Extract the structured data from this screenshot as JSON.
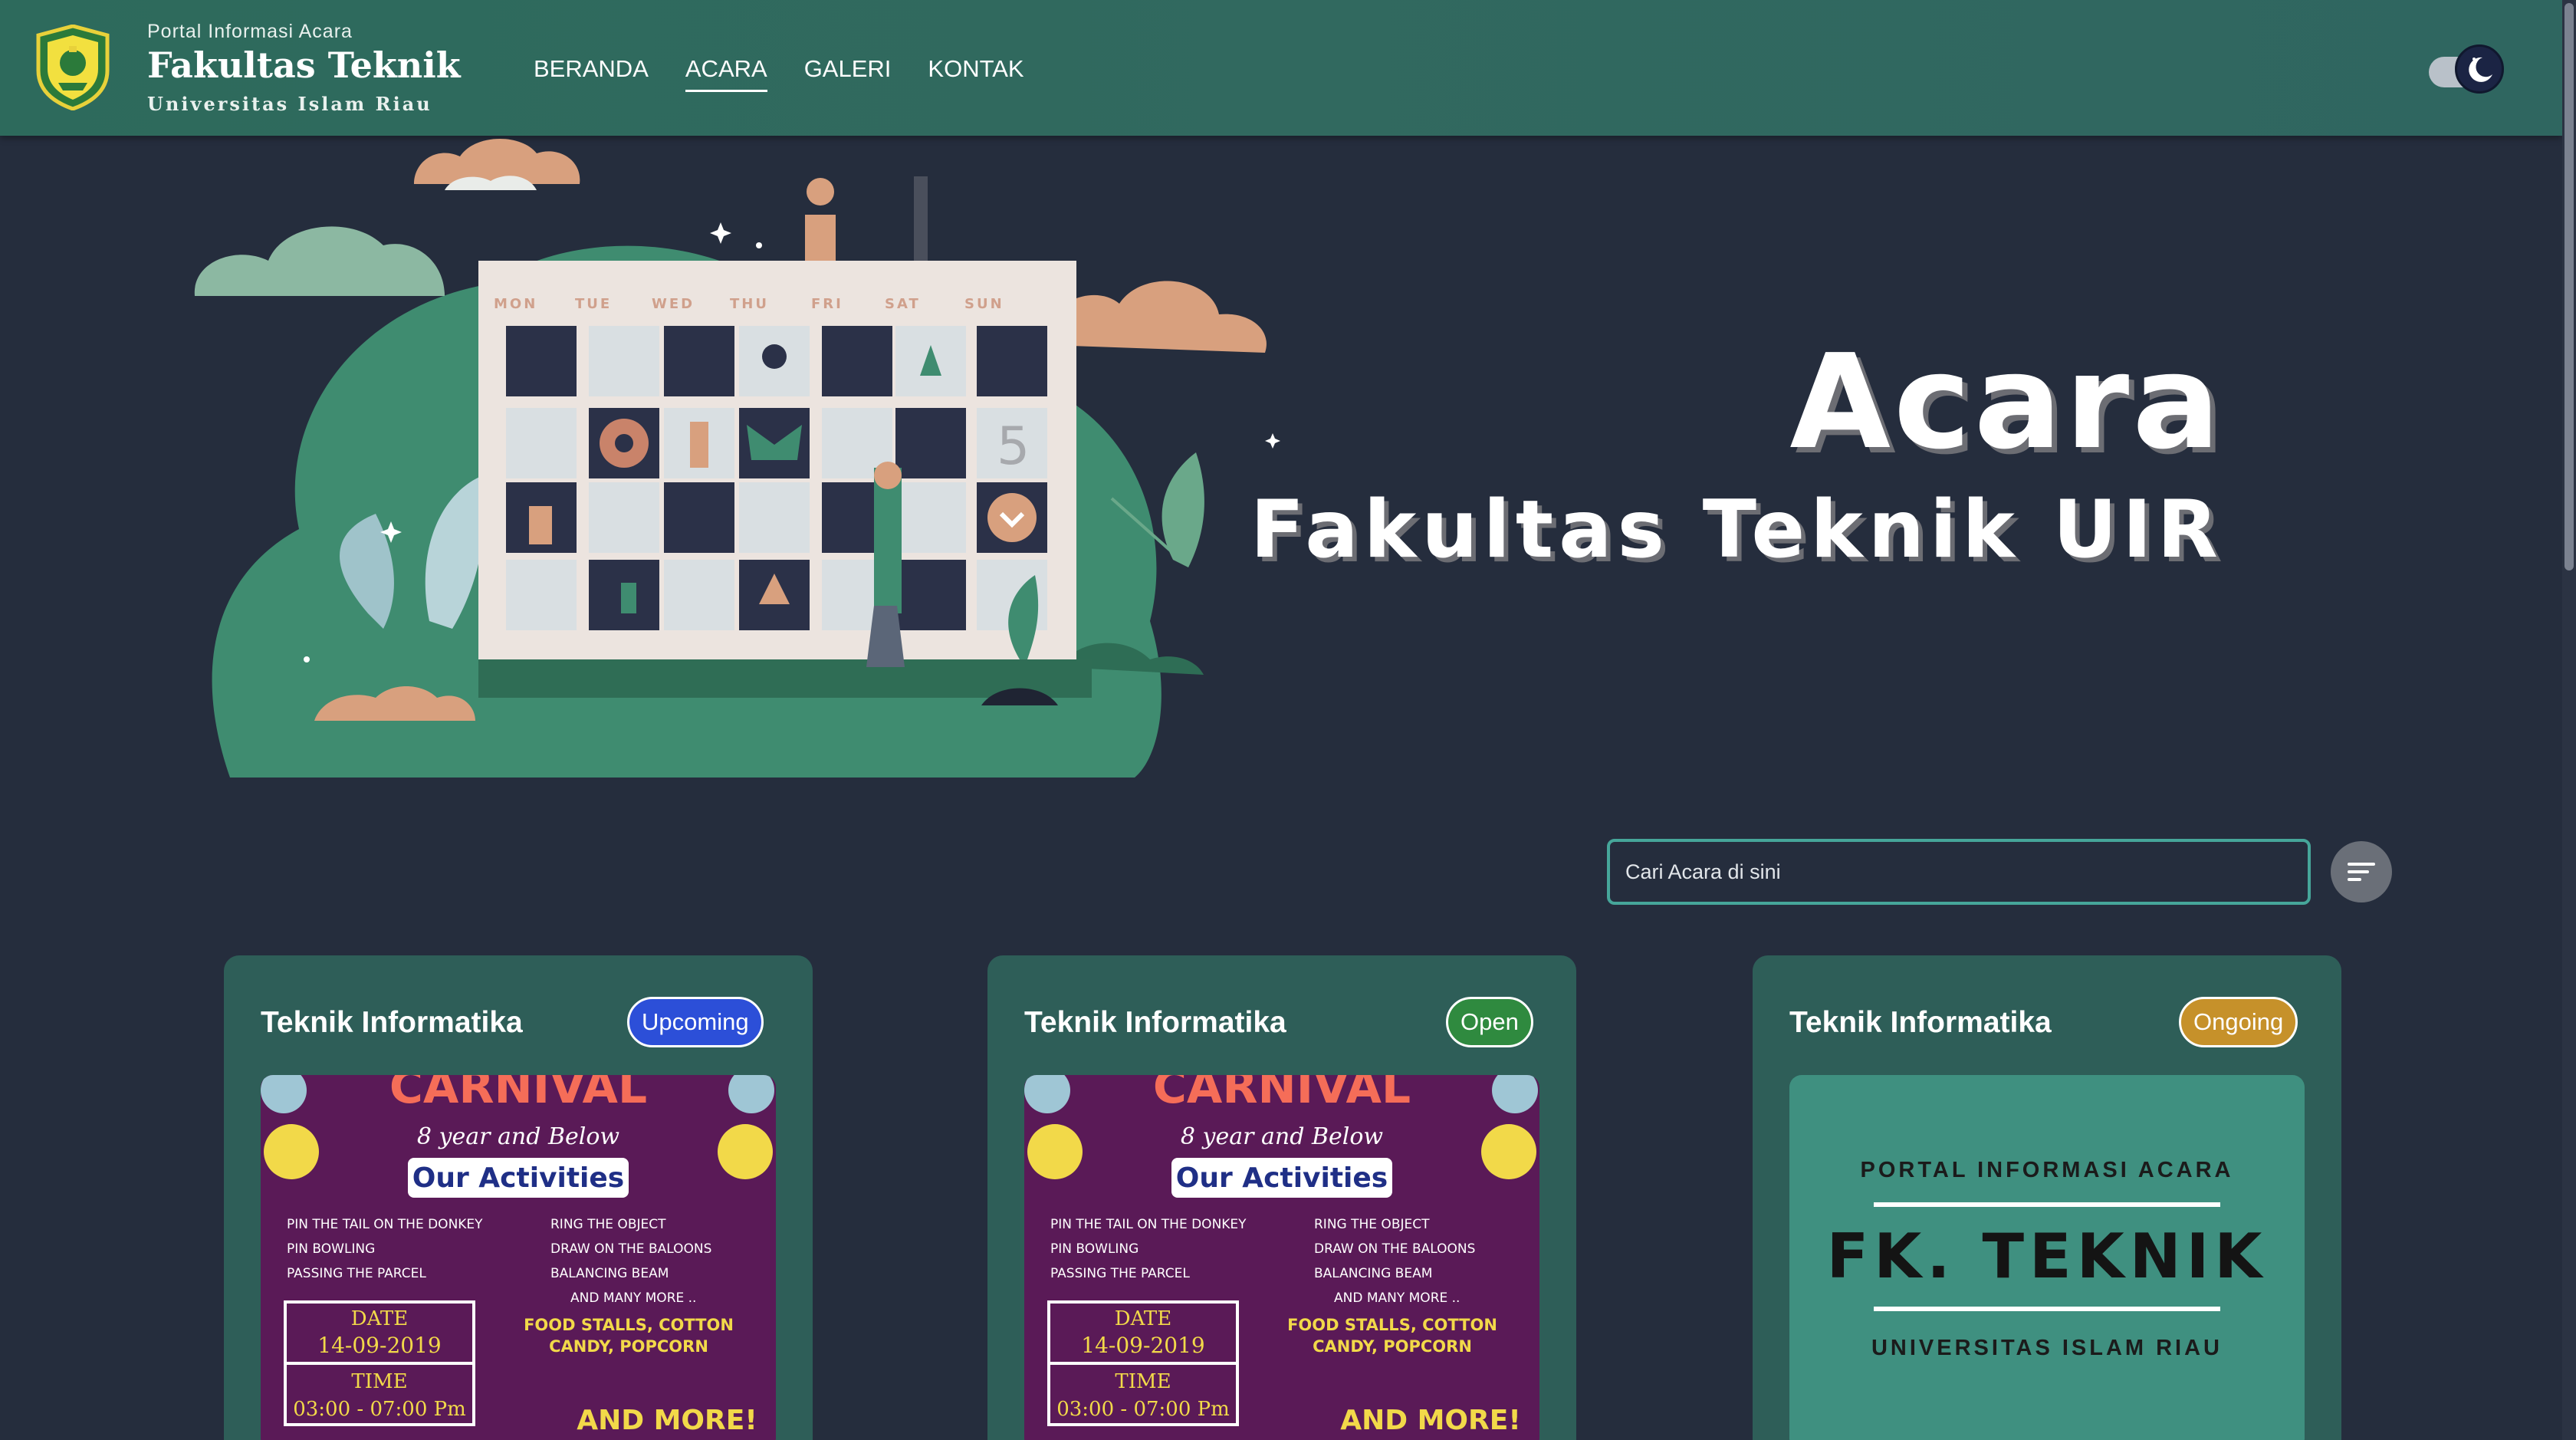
{
  "header": {
    "portal_label": "Portal Informasi Acara",
    "faculty_title": "Fakultas Teknik",
    "university": "Universitas Islam Riau",
    "logo_icon": "uir-crest-icon"
  },
  "nav": {
    "items": [
      {
        "label": "BERANDA",
        "active": false
      },
      {
        "label": "ACARA",
        "active": true
      },
      {
        "label": "GALERI",
        "active": false
      },
      {
        "label": "KONTAK",
        "active": false
      }
    ]
  },
  "theme_toggle": {
    "icon": "moon-icon",
    "mode": "dark"
  },
  "hero": {
    "title": "Acara",
    "subtitle": "Fakultas Teknik UIR",
    "calendar_days": [
      "MON",
      "TUE",
      "WED",
      "THU",
      "FRI",
      "SAT",
      "SUN"
    ],
    "calendar_number": "5"
  },
  "search": {
    "placeholder": "Cari Acara di sini",
    "value": ""
  },
  "filter": {
    "icon": "sort-filter-icon"
  },
  "cards": [
    {
      "department": "Teknik Informatika",
      "status": "Upcoming",
      "status_color": "#2c4fd8",
      "poster": {
        "headline": "CARNIVAL",
        "subheadline": "8 year and Below",
        "activities_title": "Our Activities",
        "activities_left": [
          "PIN THE TAIL ON THE DONKEY",
          "PIN BOWLING",
          "PASSING THE PARCEL"
        ],
        "activities_right": [
          "RING THE OBJECT",
          "DRAW ON THE BALOONS",
          "BALANCING BEAM",
          "AND MANY MORE .."
        ],
        "date_label": "DATE",
        "date_value": "14-09-2019",
        "time_label": "TIME",
        "time_value": "03:00 - 07:00 Pm",
        "extras": "FOOD STALLS, COTTON CANDY, POPCORN",
        "more": "AND MORE!"
      }
    },
    {
      "department": "Teknik Informatika",
      "status": "Open",
      "status_color": "#2f8a3f",
      "poster": {
        "headline": "CARNIVAL",
        "subheadline": "8 year and Below",
        "activities_title": "Our Activities",
        "activities_left": [
          "PIN THE TAIL ON THE DONKEY",
          "PIN BOWLING",
          "PASSING THE PARCEL"
        ],
        "activities_right": [
          "RING THE OBJECT",
          "DRAW ON THE BALOONS",
          "BALANCING BEAM",
          "AND MANY MORE .."
        ],
        "date_label": "DATE",
        "date_value": "14-09-2019",
        "time_label": "TIME",
        "time_value": "03:00 - 07:00 Pm",
        "extras": "FOOD STALLS, COTTON CANDY, POPCORN",
        "more": "AND MORE!"
      }
    },
    {
      "department": "Teknik Informatika",
      "status": "Ongoing",
      "status_color": "#c6912a",
      "poster": {
        "top_text": "PORTAL INFORMASI ACARA",
        "main_text": "FK. TEKNIK",
        "bottom_text": "UNIVERSITAS ISLAM RIAU"
      }
    }
  ]
}
